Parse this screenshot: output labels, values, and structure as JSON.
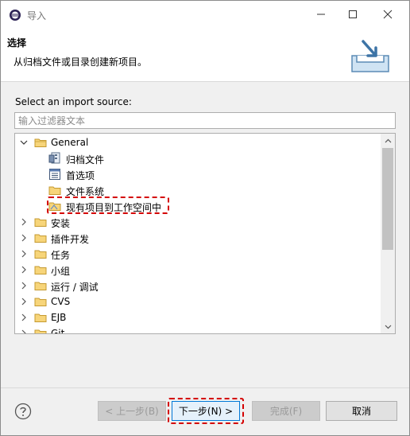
{
  "window": {
    "title": "导入"
  },
  "header": {
    "title": "选择",
    "description": "从归档文件或目录创建新项目。"
  },
  "body": {
    "prompt": "Select an import source:",
    "filter": {
      "placeholder": "输入过滤器文本",
      "value": ""
    }
  },
  "tree": {
    "general": "General",
    "general_children": [
      "归档文件",
      "首选项",
      "文件系统",
      "现有项目到工作空间中"
    ],
    "categories": [
      "安装",
      "插件开发",
      "任务",
      "小组",
      "运行 / 调试",
      "CVS",
      "EJB",
      "Git"
    ]
  },
  "buttons": {
    "back": "< 上一步(B)",
    "next": "下一步(N) >",
    "finish": "完成(F)",
    "cancel": "取消"
  },
  "colors": {
    "highlight": "#d40000",
    "accent": "#0078d7"
  },
  "icons": [
    "eclipse-icon",
    "minimize-icon",
    "maximize-icon",
    "close-icon",
    "import-wizard-icon",
    "help-icon",
    "folder-icon",
    "archive-icon",
    "preferences-icon"
  ]
}
